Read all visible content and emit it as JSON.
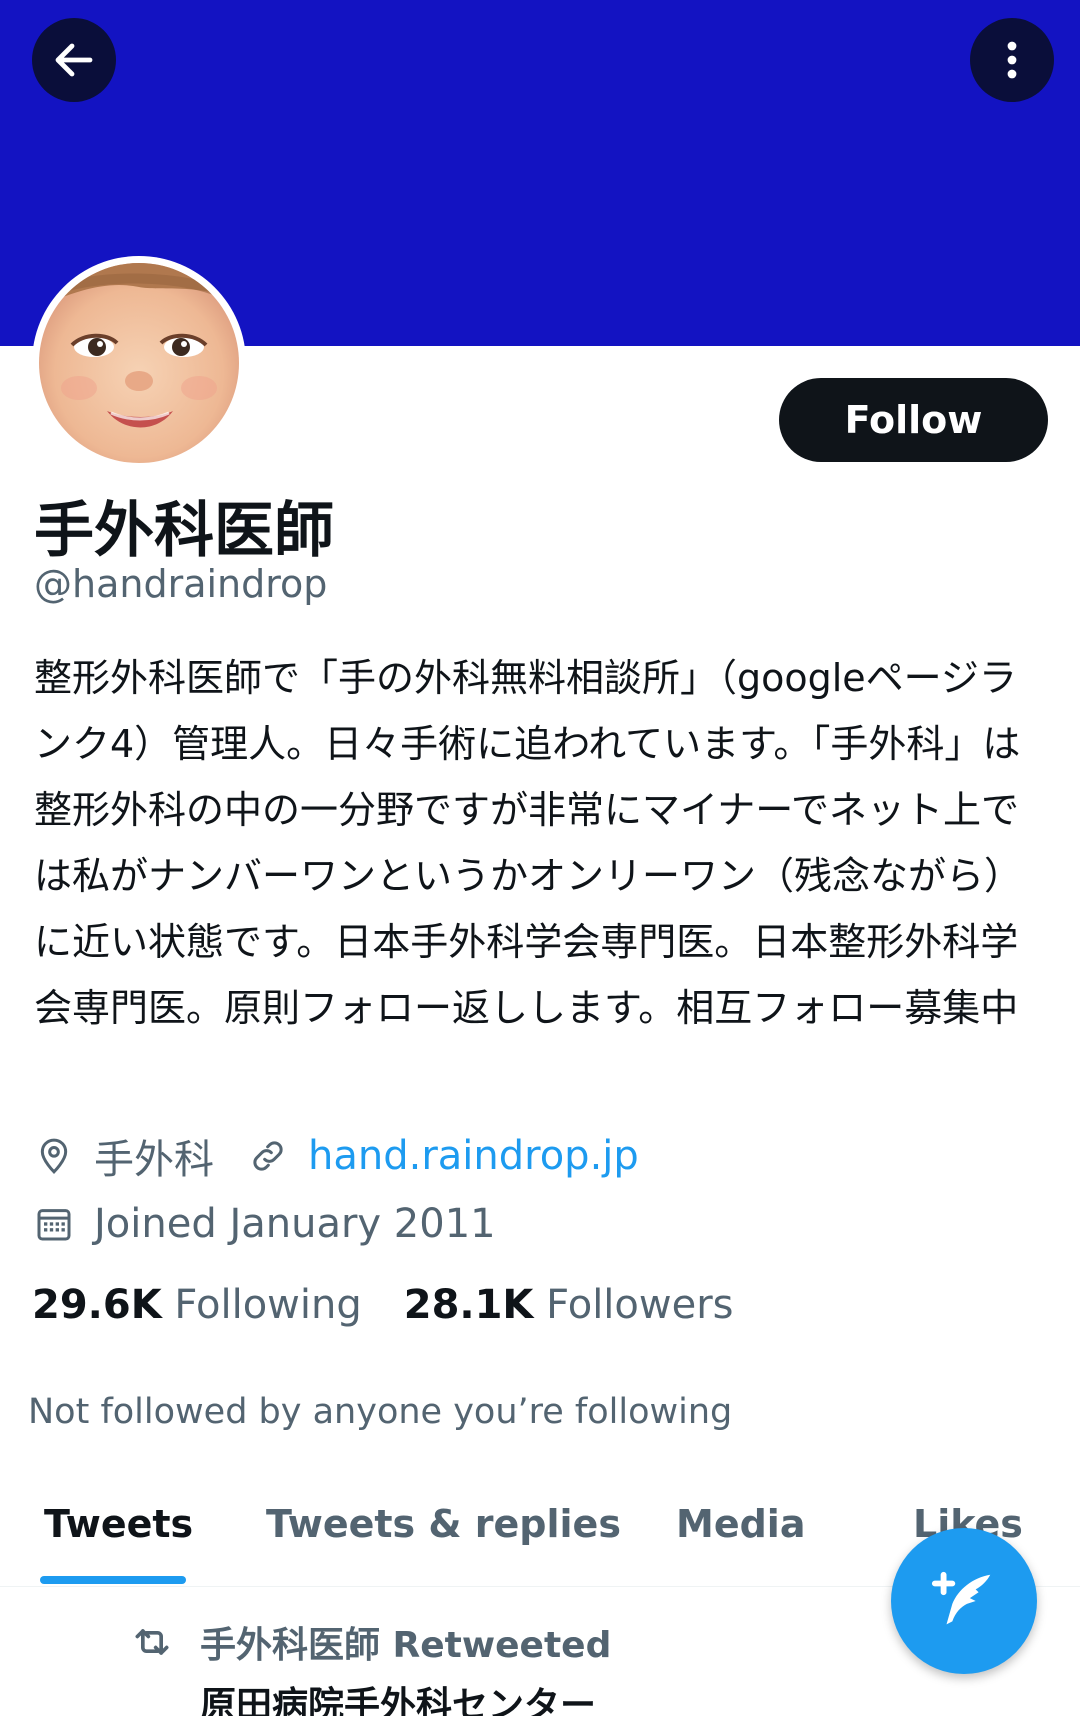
{
  "header": {
    "banner_color": "#1313c2",
    "back_icon": "arrow-left-icon",
    "more_icon": "more-vertical-icon"
  },
  "profile": {
    "display_name": "手外科医師",
    "handle": "@handraindrop",
    "follow_label": "Follow",
    "bio": "整形外科医師で「手の外科無料相談所」（googleページランク4）管理人。日々手術に追われています。「手外科」は整形外科の中の一分野ですが非常にマイナーでネット上では私がナンバーワンというかオンリーワン（残念ながら）に近い状態です。日本手外科学会専門医。日本整形外科学会専門医。原則フォロー返しします。相互フォロー募集中",
    "location": "手外科",
    "website": "hand.raindrop.jp",
    "joined": "Joined January 2011",
    "following_count": "29.6K",
    "following_label": "Following",
    "followers_count": "28.1K",
    "followers_label": "Followers",
    "not_followed_text": "Not followed by anyone you’re following"
  },
  "tabs": [
    {
      "label": "Tweets",
      "active": true
    },
    {
      "label": "Tweets & replies",
      "active": false
    },
    {
      "label": "Media",
      "active": false
    },
    {
      "label": "Likes",
      "active": false
    }
  ],
  "timeline": {
    "retweet_label": "手外科医師 Retweeted",
    "next_author": "原田病院手外科センター"
  },
  "colors": {
    "accent": "#1d9bf0",
    "text_primary": "#0f1419",
    "text_secondary": "#536471"
  },
  "fab": {
    "icon": "compose-tweet-icon"
  }
}
